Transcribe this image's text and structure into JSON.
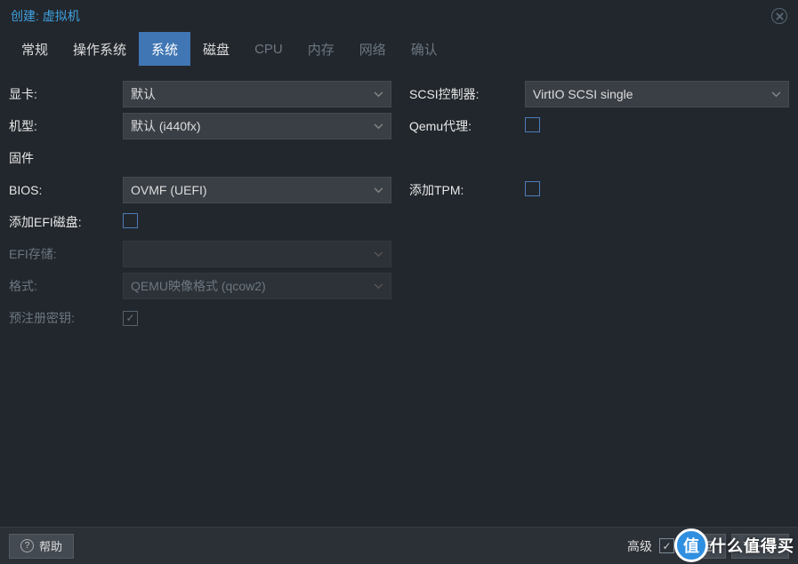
{
  "header": {
    "title": "创建: 虚拟机"
  },
  "tabs": [
    {
      "label": "常规",
      "state": "normal"
    },
    {
      "label": "操作系统",
      "state": "normal"
    },
    {
      "label": "系统",
      "state": "active"
    },
    {
      "label": "磁盘",
      "state": "normal"
    },
    {
      "label": "CPU",
      "state": "disabled"
    },
    {
      "label": "内存",
      "state": "disabled"
    },
    {
      "label": "网络",
      "state": "disabled"
    },
    {
      "label": "确认",
      "state": "disabled"
    }
  ],
  "left": {
    "graphics_label": "显卡:",
    "graphics_value": "默认",
    "machine_label": "机型:",
    "machine_value": "默认 (i440fx)",
    "firmware_heading": "固件",
    "bios_label": "BIOS:",
    "bios_value": "OVMF (UEFI)",
    "add_efi_label": "添加EFI磁盘:",
    "add_efi_checked": false,
    "efi_storage_label": "EFI存储:",
    "efi_storage_value": "",
    "format_label": "格式:",
    "format_value": "QEMU映像格式 (qcow2)",
    "preenroll_label": "预注册密钥:",
    "preenroll_checked": true
  },
  "right": {
    "scsi_label": "SCSI控制器:",
    "scsi_value": "VirtIO SCSI single",
    "qemu_agent_label": "Qemu代理:",
    "qemu_agent_checked": false,
    "add_tpm_label": "添加TPM:",
    "add_tpm_checked": false
  },
  "footer": {
    "help_label": "帮助",
    "advanced_label": "高级",
    "advanced_checked": true,
    "back_label": "返回",
    "next_label": "下一步"
  },
  "watermark": {
    "badge_char": "值",
    "text": "什么值得买"
  }
}
